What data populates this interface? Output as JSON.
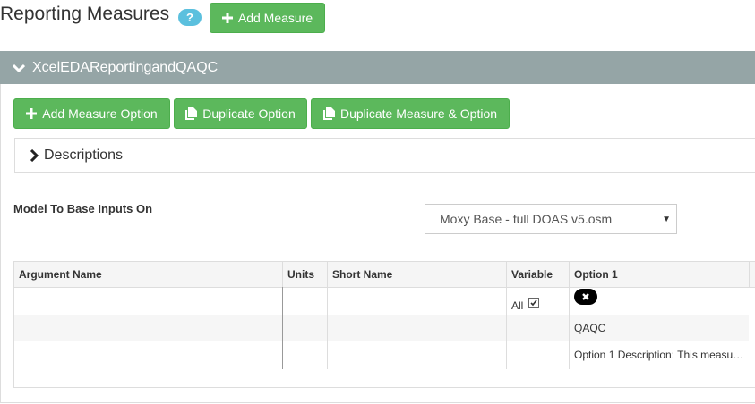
{
  "page": {
    "title": "Reporting Measures",
    "help_badge": "?",
    "add_measure_label": "Add Measure"
  },
  "measure": {
    "name": "XcelEDAReportingandQAQC",
    "add_option_label": "Add Measure Option",
    "duplicate_option_label": "Duplicate Option",
    "duplicate_measure_option_label": "Duplicate Measure & Option",
    "descriptions_label": "Descriptions",
    "model_label": "Model To Base Inputs On",
    "model_selected": "Moxy Base - full DOAS v5.osm"
  },
  "table": {
    "headers": {
      "argument_name": "Argument Name",
      "units": "Units",
      "short_name": "Short Name",
      "variable": "Variable",
      "option1": "Option 1"
    },
    "variable_all_label": "All",
    "variable_all_checked": true,
    "option_name": "QAQC",
    "option_description": "Option 1 Description: This measu…"
  },
  "colors": {
    "accent_green": "#5cb85c",
    "header_gray": "#95a5a6",
    "help_blue": "#5bc0de"
  },
  "icons": [
    "plus-icon",
    "copy-icon",
    "chevron-down-icon",
    "chevron-right-icon",
    "remove-icon",
    "checkbox"
  ]
}
